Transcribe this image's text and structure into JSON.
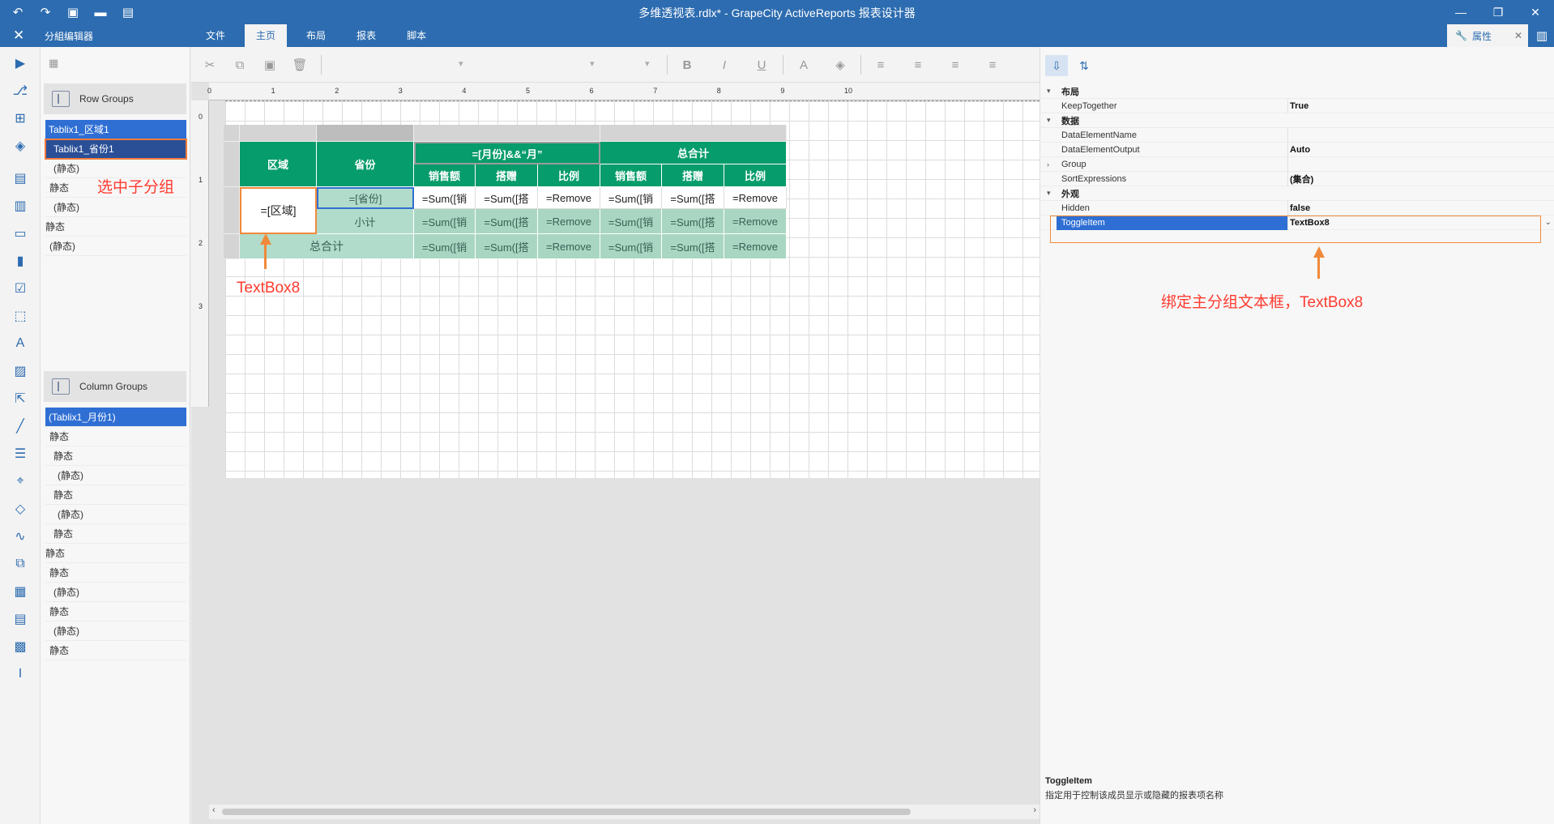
{
  "window": {
    "title": "多维透视表.rdlx* - GrapeCity ActiveReports 报表设计器",
    "controls": [
      "minimize-icon",
      "restore-icon",
      "close-icon"
    ]
  },
  "tabbar": {
    "close_glyph": "✕",
    "group_editor_label": "分組编辑器",
    "tabs": [
      {
        "label": "文件",
        "active": false
      },
      {
        "label": "主页",
        "active": true
      },
      {
        "label": "布局",
        "active": false
      },
      {
        "label": "报表",
        "active": false
      },
      {
        "label": "脚本",
        "active": false
      }
    ],
    "properties_tab_label": "属性"
  },
  "groups": {
    "row_groups_title": "Row Groups",
    "row_items": [
      {
        "label": "Tablix1_区域1",
        "indent": 0,
        "state": "selected"
      },
      {
        "label": "Tablix1_省份1",
        "indent": 1,
        "state": "active"
      },
      {
        "label": "(静态)",
        "indent": 2,
        "state": ""
      },
      {
        "label": "静态",
        "indent": 1,
        "state": ""
      },
      {
        "label": "(静态)",
        "indent": 2,
        "state": ""
      },
      {
        "label": "静态",
        "indent": 0,
        "state": ""
      },
      {
        "label": "(静态)",
        "indent": 1,
        "state": ""
      }
    ],
    "column_groups_title": "Column Groups",
    "column_items": [
      {
        "label": "(Tablix1_月份1)",
        "indent": 0,
        "state": "selected"
      },
      {
        "label": "静态",
        "indent": 1,
        "state": ""
      },
      {
        "label": "静态",
        "indent": 2,
        "state": ""
      },
      {
        "label": "(静态)",
        "indent": 3,
        "state": ""
      },
      {
        "label": "静态",
        "indent": 2,
        "state": ""
      },
      {
        "label": "(静态)",
        "indent": 3,
        "state": ""
      },
      {
        "label": "静态",
        "indent": 2,
        "state": ""
      },
      {
        "label": "静态",
        "indent": 0,
        "state": ""
      },
      {
        "label": "静态",
        "indent": 1,
        "state": ""
      },
      {
        "label": "(静态)",
        "indent": 2,
        "state": ""
      },
      {
        "label": "静态",
        "indent": 1,
        "state": ""
      },
      {
        "label": "(静态)",
        "indent": 2,
        "state": ""
      },
      {
        "label": "静态",
        "indent": 1,
        "state": ""
      }
    ]
  },
  "ruler": {
    "h_marks": [
      "0",
      "1",
      "2",
      "3",
      "4",
      "5",
      "6",
      "7",
      "8",
      "9",
      "10"
    ],
    "v_marks": [
      "0",
      "1",
      "2",
      "3"
    ]
  },
  "tablix": {
    "h_region": "区域",
    "h_province": "省份",
    "h_month": "=[月份]&&“月”",
    "h_total": "总合计",
    "sub_sales": "销售额",
    "sub_gift": "搭赠",
    "sub_ratio": "比例",
    "cell_region": "=[区域]",
    "cell_province": "=[省份]",
    "subtotal": "小计",
    "grand_total": "总合计",
    "sum_sales": "=Sum([销",
    "sum_gift": "=Sum([搭",
    "remove": "=Remove"
  },
  "annotations": {
    "select_child": "选中子分组",
    "textbox_label": "TextBox8",
    "bind_note": "绑定主分组文本框，TextBox8"
  },
  "properties": {
    "rows": [
      {
        "type": "cat",
        "name": "布局"
      },
      {
        "type": "prop",
        "name": "KeepTogether",
        "value": "True"
      },
      {
        "type": "cat",
        "name": "数据"
      },
      {
        "type": "prop",
        "name": "DataElementName",
        "value": ""
      },
      {
        "type": "prop",
        "name": "DataElementOutput",
        "value": "Auto"
      },
      {
        "type": "expand",
        "name": "Group",
        "value": ""
      },
      {
        "type": "prop",
        "name": "SortExpressions",
        "value": "(集合)"
      },
      {
        "type": "cat",
        "name": "外观"
      },
      {
        "type": "prop",
        "name": "Hidden",
        "value": "false"
      },
      {
        "type": "sel",
        "name": "ToggleItem",
        "value": "TextBox8"
      }
    ],
    "help_title": "ToggleItem",
    "help_text": "指定用于控制该成员显示或隐藏的报表项名称"
  },
  "colors": {
    "title_bar": "#2d6cb0",
    "header_green": "#079c6b",
    "annotation_red": "#ff3b30",
    "annotation_orange": "#f08a3a",
    "selection_blue": "#2f6fd4"
  }
}
